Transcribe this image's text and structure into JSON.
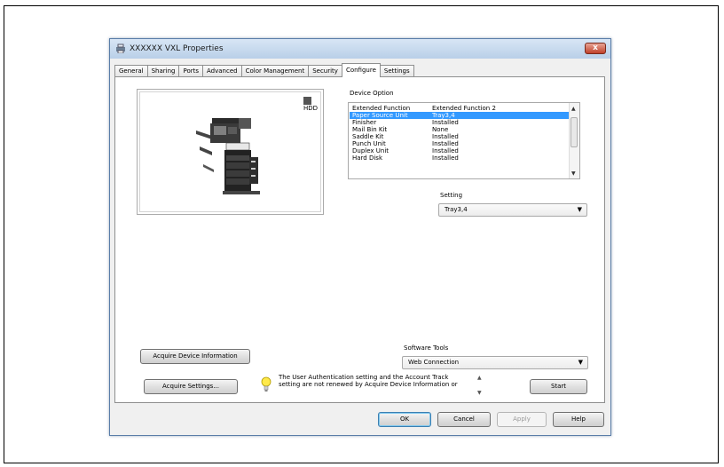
{
  "window": {
    "title": "XXXXXX VXL Properties",
    "close_label": "x"
  },
  "tabs": [
    {
      "label": "General"
    },
    {
      "label": "Sharing"
    },
    {
      "label": "Ports"
    },
    {
      "label": "Advanced"
    },
    {
      "label": "Color Management"
    },
    {
      "label": "Security"
    },
    {
      "label": "Configure"
    },
    {
      "label": "Settings"
    }
  ],
  "active_tab": "Configure",
  "preview": {
    "hdd_label": "HDD"
  },
  "device_option": {
    "label": "Device Option",
    "rows": [
      {
        "name": "Extended Function",
        "value": "Extended Function 2",
        "selected": false
      },
      {
        "name": "Paper Source Unit",
        "value": "Tray3,4",
        "selected": true
      },
      {
        "name": "Finisher",
        "value": "Installed",
        "selected": false
      },
      {
        "name": "Mail Bin Kit",
        "value": "None",
        "selected": false
      },
      {
        "name": "Saddle Kit",
        "value": "Installed",
        "selected": false
      },
      {
        "name": "Punch Unit",
        "value": "Installed",
        "selected": false
      },
      {
        "name": "Duplex Unit",
        "value": "Installed",
        "selected": false
      },
      {
        "name": "Hard Disk",
        "value": "Installed",
        "selected": false
      }
    ]
  },
  "setting": {
    "label": "Setting",
    "value": "Tray3,4"
  },
  "software_tools": {
    "label": "Software Tools",
    "value": "Web Connection"
  },
  "buttons": {
    "acquire_device": "Acquire Device Information",
    "acquire_settings": "Acquire Settings...",
    "start": "Start",
    "ok": "OK",
    "cancel": "Cancel",
    "apply": "Apply",
    "help": "Help"
  },
  "note": {
    "line1": "The User Authentication setting and the Account Track",
    "line2": "setting are not renewed by Acquire Device Information or"
  },
  "colors": {
    "selection": "#3399ff",
    "titlebar": "#c7d9ef",
    "close": "#c7432f"
  }
}
